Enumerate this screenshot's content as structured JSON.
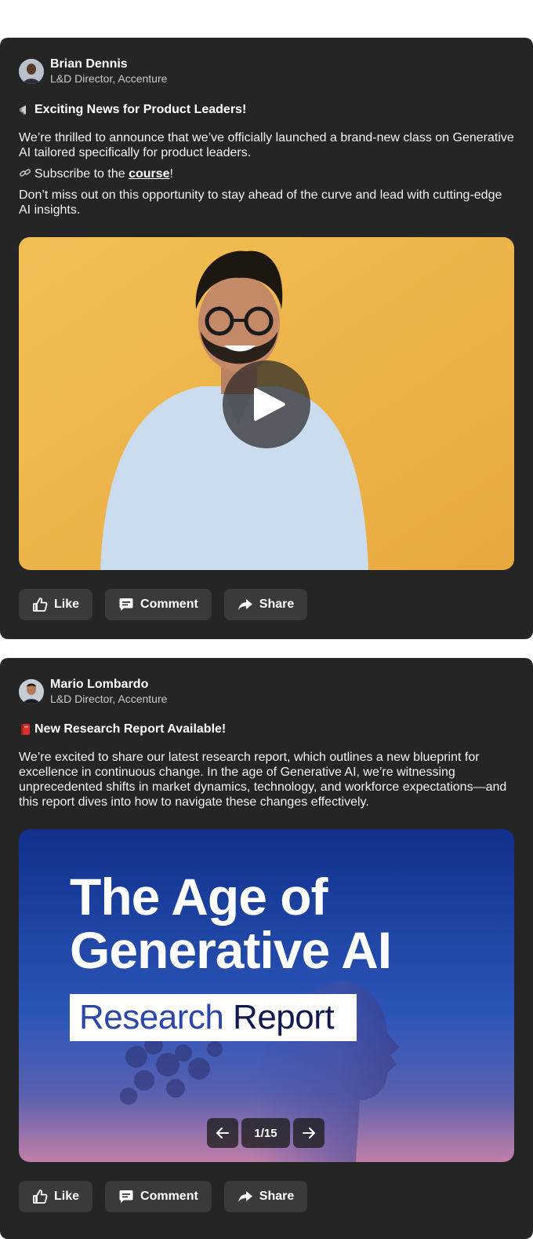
{
  "posts": [
    {
      "author": {
        "name": "Brian Dennis",
        "title": "L&D Director, Accenture"
      },
      "headline": "Exciting News for Product Leaders!",
      "headline_emoji": "megaphone-icon",
      "paragraph1": "We’re thrilled to announce that we’ve officially launched a brand-new class on Generative AI tailored specifically for product leaders.",
      "subscribe_prefix": "Subscribe to the ",
      "subscribe_link": "course",
      "subscribe_suffix": "!",
      "paragraph2": "Don’t miss out on this opportunity to stay ahead of the curve and lead with cutting-edge AI insights.",
      "media_type": "video",
      "actions": {
        "like": "Like",
        "comment": "Comment",
        "share": "Share"
      }
    },
    {
      "author": {
        "name": "Mario Lombardo",
        "title": "L&D Director, Accenture"
      },
      "headline": "New Research Report Available!",
      "headline_emoji": "book-icon",
      "paragraph1": "We’re excited to share our latest research report, which outlines a new blueprint for excellence in continuous change. In the age of Generative AI, we’re witnessing unprecedented shifts in market dynamics, technology, and workforce expectations—and this report dives into how to navigate these changes effectively.",
      "media_type": "carousel",
      "slide": {
        "title_line1": "The Age of",
        "title_line2": "Generative AI",
        "subtitle_part1": "Research",
        "subtitle_part2": " Report"
      },
      "pager": {
        "current": "1/15"
      },
      "actions": {
        "like": "Like",
        "comment": "Comment",
        "share": "Share"
      }
    }
  ],
  "colors": {
    "card": "#252525",
    "button": "#3a3a3a",
    "video_bg": "#eab34a",
    "slide_bg": "#1a3d9a"
  }
}
